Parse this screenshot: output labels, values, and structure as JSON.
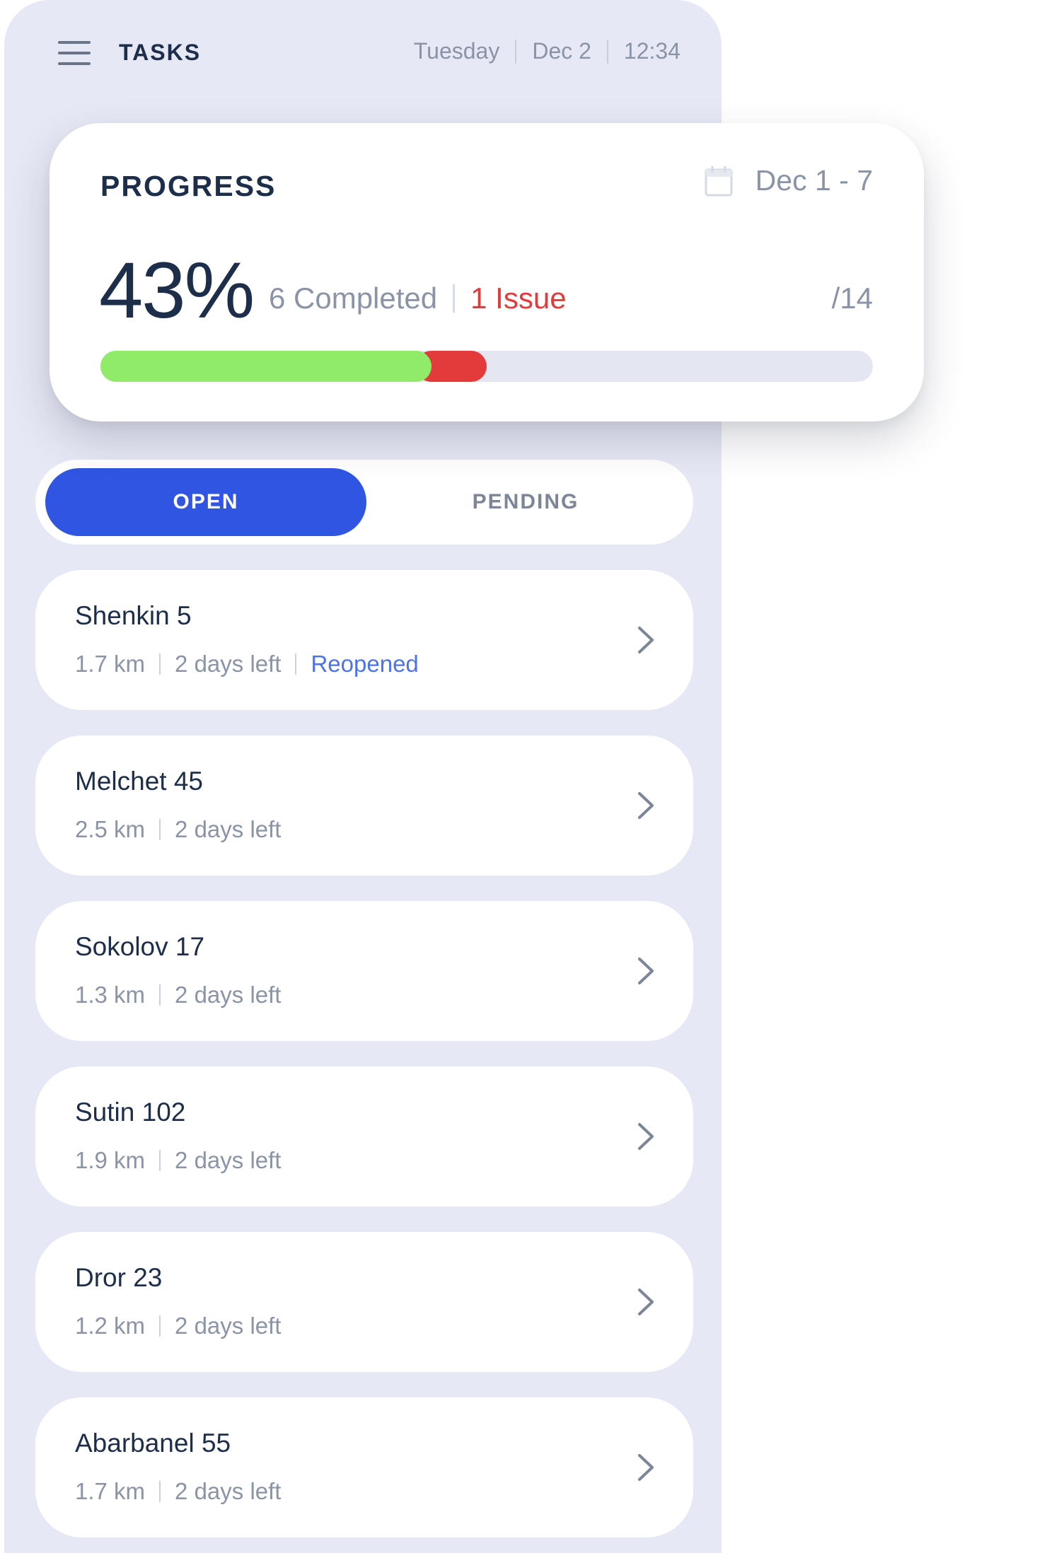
{
  "header": {
    "title": "TASKS",
    "day": "Tuesday",
    "date": "Dec 2",
    "time": "12:34"
  },
  "progress": {
    "title": "PROGRESS",
    "date_range": "Dec 1 - 7",
    "percent": "43%",
    "completed_label": "6 Completed",
    "issue_label": "1 Issue",
    "total_label": "/14",
    "completed_count": 6,
    "issue_count": 1,
    "total_count": 14,
    "colors": {
      "completed": "#90ec68",
      "issue": "#e33b3b",
      "remaining": "#e4e6f1"
    }
  },
  "tabs": [
    {
      "label": "OPEN",
      "active": true
    },
    {
      "label": "PENDING",
      "active": false
    }
  ],
  "accent_color": "#2f55e2",
  "tasks": [
    {
      "name": "Shenkin 5",
      "distance": "1.7 km",
      "time_left": "2 days left",
      "status": "Reopened"
    },
    {
      "name": "Melchet 45",
      "distance": "2.5 km",
      "time_left": "2 days left"
    },
    {
      "name": "Sokolov 17",
      "distance": "1.3 km",
      "time_left": "2 days left"
    },
    {
      "name": "Sutin 102",
      "distance": "1.9 km",
      "time_left": "2 days left"
    },
    {
      "name": "Dror 23",
      "distance": "1.2 km",
      "time_left": "2 days left"
    },
    {
      "name": "Abarbanel 55",
      "distance": "1.7 km",
      "time_left": "2 days left"
    }
  ],
  "icons": {
    "menu": "hamburger-menu-icon",
    "calendar": "calendar-icon",
    "row_arrow": "chevron-right-icon"
  }
}
